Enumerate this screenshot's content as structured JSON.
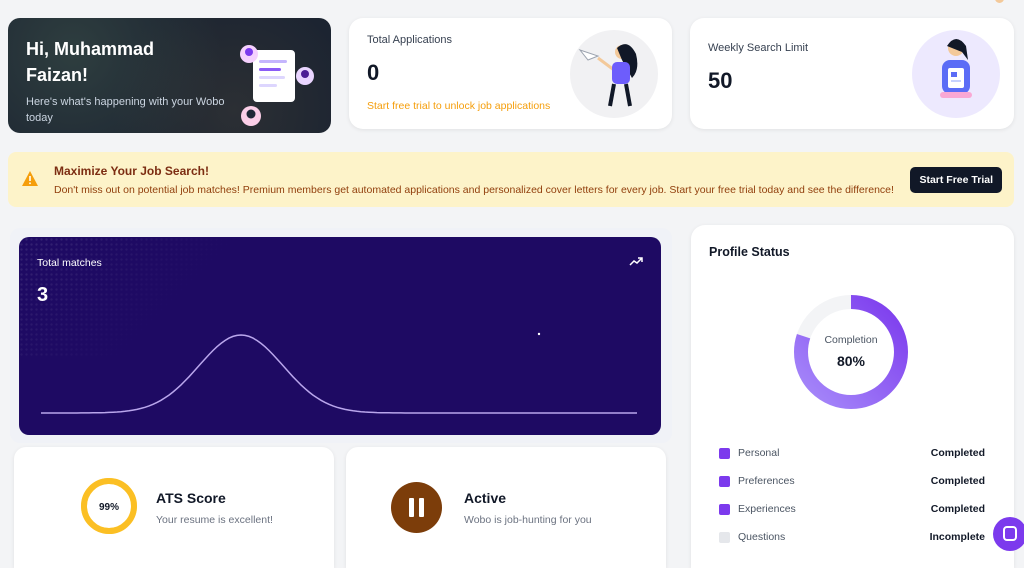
{
  "welcome": {
    "greeting": "Hi, Muhammad Faizan!",
    "subtitle": "Here's what's happening with your Wobo today"
  },
  "stats": [
    {
      "label": "Total Applications",
      "value": "0",
      "note": "Start free trial to unlock job applications"
    },
    {
      "label": "Weekly Search Limit",
      "value": "50"
    }
  ],
  "banner": {
    "title": "Maximize Your Job Search!",
    "description": "Don't miss out on potential job matches! Premium members get automated applications and personalized cover letters for every job. Start your free trial today and see the difference!",
    "button_label": "Start Free Trial"
  },
  "matches": {
    "label": "Total matches",
    "value": "3"
  },
  "ats": {
    "score_text": "99%",
    "score": 0.99,
    "title": "ATS Score",
    "description": "Your resume is excellent!"
  },
  "activity": {
    "title": "Active",
    "description": "Wobo is job-hunting for you"
  },
  "profile": {
    "title": "Profile Status",
    "completion_label": "Completion",
    "completion_text": "80%",
    "completion": 0.8,
    "items": [
      {
        "name": "Personal",
        "status": "Completed"
      },
      {
        "name": "Preferences",
        "status": "Completed"
      },
      {
        "name": "Experiences",
        "status": "Completed"
      },
      {
        "name": "Questions",
        "status": "Incomplete"
      }
    ]
  },
  "colors": {
    "accent": "#7c3aed",
    "matches_bg": "#1e0a63",
    "warning": "#f59e0b",
    "banner_bg": "#fdf3c9",
    "active_icon": "#7c3d0a"
  },
  "icons": [
    "warning-icon",
    "trending-up-icon",
    "pause-icon",
    "chat-icon"
  ]
}
